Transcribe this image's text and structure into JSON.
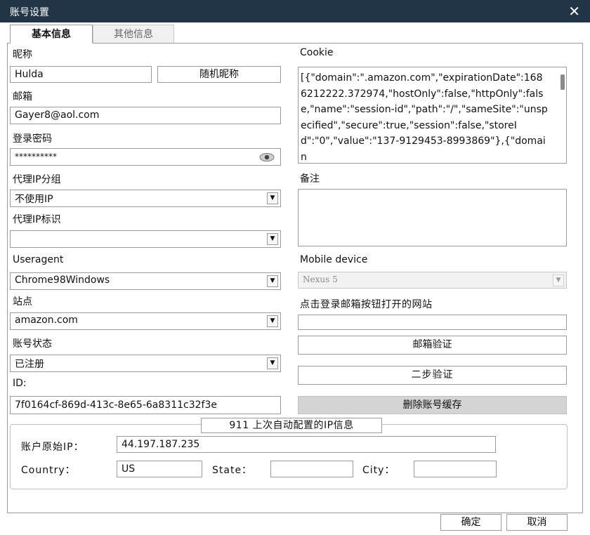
{
  "window": {
    "title": "账号设置"
  },
  "tabs": [
    {
      "label": "基本信息",
      "active": true
    },
    {
      "label": "其他信息",
      "active": false
    }
  ],
  "left": {
    "nickname": {
      "label": "昵称",
      "value": "Hulda",
      "random_button": "随机昵称"
    },
    "email": {
      "label": "邮箱",
      "value": "Gayer8@aol.com"
    },
    "password": {
      "label": "登录密码",
      "value": "**********",
      "toggle_icon": "eye-icon"
    },
    "proxy_group": {
      "label": "代理IP分组",
      "selected": "不使用IP"
    },
    "proxy_tag": {
      "label": "代理IP标识",
      "selected": ""
    },
    "useragent": {
      "label": "Useragent",
      "selected": "Chrome98Windows"
    },
    "site": {
      "label": "站点",
      "selected": "amazon.com"
    },
    "account_status": {
      "label": "账号状态",
      "selected": "已注册"
    },
    "id": {
      "label": "ID:",
      "value": "7f0164cf-869d-413c-8e65-6a8311c32f3e"
    }
  },
  "right": {
    "cookie": {
      "label": "Cookie",
      "value": "[{\"domain\":\".amazon.com\",\"expirationDate\":1686212222.372974,\"hostOnly\":false,\"httpOnly\":false,\"name\":\"session-id\",\"path\":\"/\",\"sameSite\":\"unspecified\",\"secure\":true,\"session\":false,\"storeId\":\"0\",\"value\":\"137-9129453-8993869\"},{\"domain"
    },
    "note": {
      "label": "备注",
      "value": ""
    },
    "mobile_device": {
      "label": "Mobile device",
      "selected": "Nexus 5"
    },
    "email_site": {
      "label": "点击登录邮箱按钮打开的网站",
      "value": ""
    },
    "email_verify_button": "邮箱验证",
    "two_step_button": "二步验证",
    "delete_cache_button": "删除账号缓存"
  },
  "ip_info": {
    "title": "911 上次自动配置的IP信息",
    "original_ip_label": "账户原始IP：",
    "original_ip": "44.197.187.235",
    "country_label": "Country：",
    "country": "US",
    "state_label": "State：",
    "state": "",
    "city_label": "City：",
    "city": ""
  },
  "footer": {
    "ok": "确定",
    "cancel": "取消"
  },
  "colors": {
    "titlebar": "#213547",
    "button_gray": "#d4d4d4",
    "border": "#9a9a9a"
  }
}
